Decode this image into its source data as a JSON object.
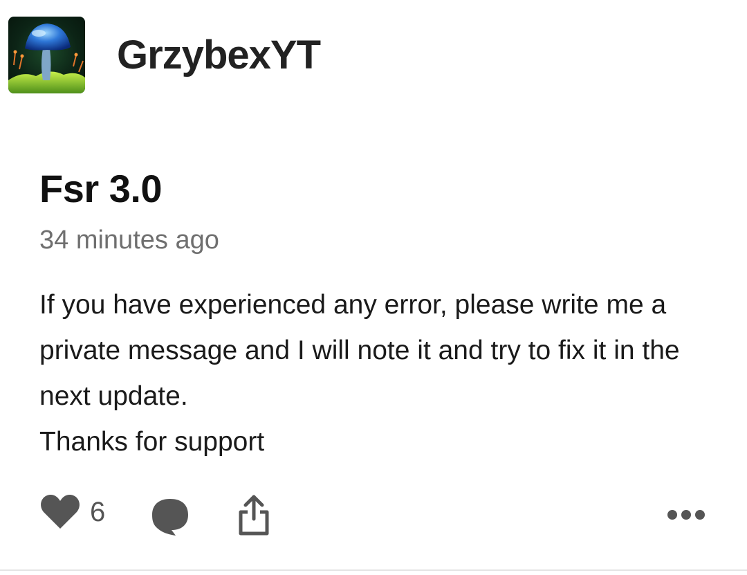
{
  "author": {
    "name": "GrzybexYT",
    "avatar_icon": "blue-mushroom-avatar"
  },
  "post": {
    "title": "Fsr 3.0",
    "timestamp": "34 minutes ago",
    "body": [
      "If you have experienced any error, please write me a private message and I will note it and try to fix it in the next update.",
      "Thanks for support"
    ]
  },
  "actions": {
    "like_icon": "heart-icon",
    "like_count": "6",
    "comment_icon": "comment-bubble-icon",
    "share_icon": "share-icon",
    "more_icon": "more-dots-icon"
  },
  "colors": {
    "text": "#1a1a1a",
    "muted": "#6f6f6f",
    "icon": "#555555",
    "divider": "#e4e4e4"
  }
}
